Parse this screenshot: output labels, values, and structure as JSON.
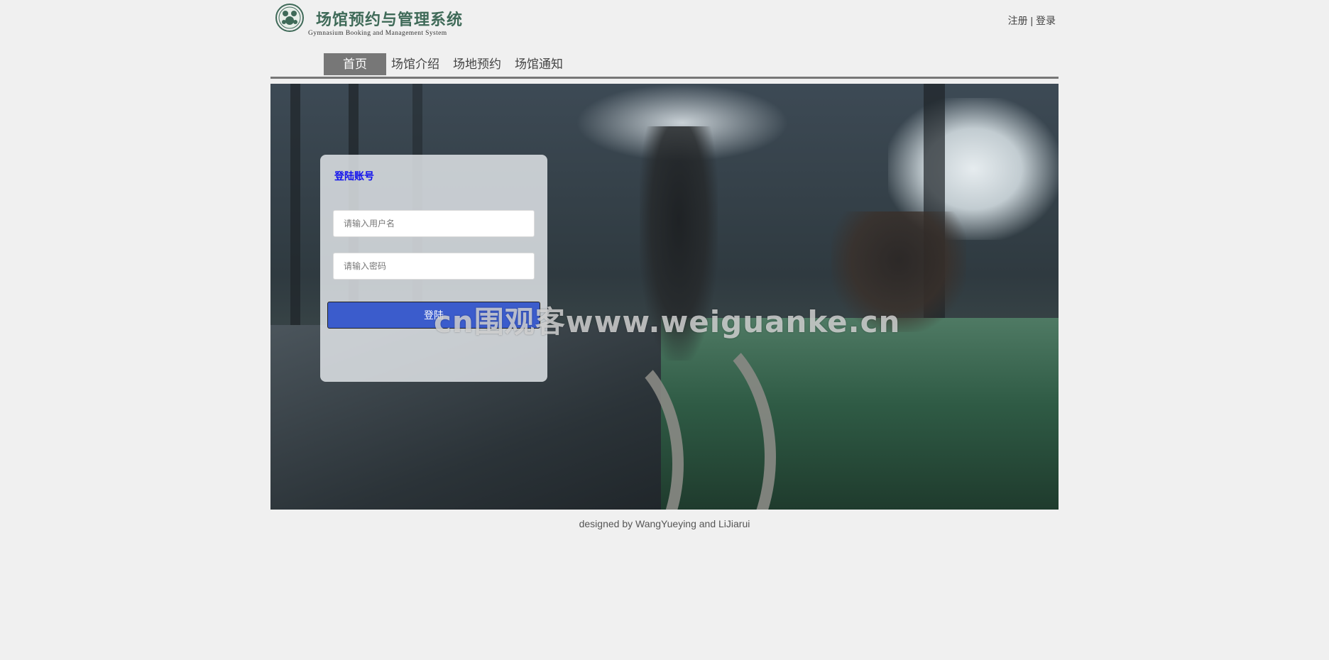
{
  "header": {
    "title": "场馆预约与管理系统",
    "subtitle": "Gymnasium Booking and Management System",
    "register_label": "注册",
    "separator": "|",
    "login_label": "登录"
  },
  "nav": {
    "items": [
      {
        "label": "首页",
        "active": true
      },
      {
        "label": "场馆介绍",
        "active": false
      },
      {
        "label": "场地预约",
        "active": false
      },
      {
        "label": "场馆通知",
        "active": false
      }
    ]
  },
  "login_panel": {
    "title": "登陆账号",
    "username_placeholder": "请输入用户名",
    "password_placeholder": "请输入密码",
    "submit_label": "登陆"
  },
  "watermark": "cn围观客www.weiguanke.cn",
  "footer": {
    "credit": "designed by WangYueying and LiJiarui"
  },
  "colors": {
    "background": "#f0f0f0",
    "nav_active": "#777777",
    "login_title": "#1010ee",
    "button": "#3b5ccc",
    "logo": "#3f6a58"
  }
}
